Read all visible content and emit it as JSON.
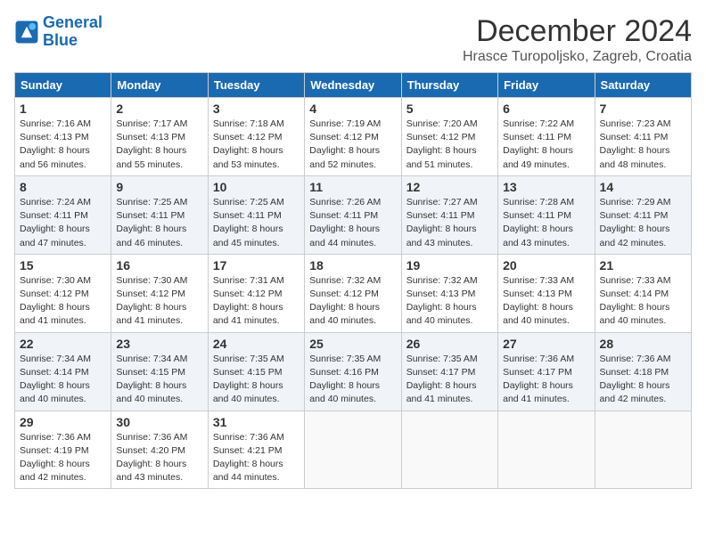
{
  "header": {
    "logo_line1": "General",
    "logo_line2": "Blue",
    "month": "December 2024",
    "location": "Hrasce Turopoljsko, Zagreb, Croatia"
  },
  "weekdays": [
    "Sunday",
    "Monday",
    "Tuesday",
    "Wednesday",
    "Thursday",
    "Friday",
    "Saturday"
  ],
  "weeks": [
    [
      {
        "day": "1",
        "sunrise": "Sunrise: 7:16 AM",
        "sunset": "Sunset: 4:13 PM",
        "daylight": "Daylight: 8 hours and 56 minutes."
      },
      {
        "day": "2",
        "sunrise": "Sunrise: 7:17 AM",
        "sunset": "Sunset: 4:13 PM",
        "daylight": "Daylight: 8 hours and 55 minutes."
      },
      {
        "day": "3",
        "sunrise": "Sunrise: 7:18 AM",
        "sunset": "Sunset: 4:12 PM",
        "daylight": "Daylight: 8 hours and 53 minutes."
      },
      {
        "day": "4",
        "sunrise": "Sunrise: 7:19 AM",
        "sunset": "Sunset: 4:12 PM",
        "daylight": "Daylight: 8 hours and 52 minutes."
      },
      {
        "day": "5",
        "sunrise": "Sunrise: 7:20 AM",
        "sunset": "Sunset: 4:12 PM",
        "daylight": "Daylight: 8 hours and 51 minutes."
      },
      {
        "day": "6",
        "sunrise": "Sunrise: 7:22 AM",
        "sunset": "Sunset: 4:11 PM",
        "daylight": "Daylight: 8 hours and 49 minutes."
      },
      {
        "day": "7",
        "sunrise": "Sunrise: 7:23 AM",
        "sunset": "Sunset: 4:11 PM",
        "daylight": "Daylight: 8 hours and 48 minutes."
      }
    ],
    [
      {
        "day": "8",
        "sunrise": "Sunrise: 7:24 AM",
        "sunset": "Sunset: 4:11 PM",
        "daylight": "Daylight: 8 hours and 47 minutes."
      },
      {
        "day": "9",
        "sunrise": "Sunrise: 7:25 AM",
        "sunset": "Sunset: 4:11 PM",
        "daylight": "Daylight: 8 hours and 46 minutes."
      },
      {
        "day": "10",
        "sunrise": "Sunrise: 7:25 AM",
        "sunset": "Sunset: 4:11 PM",
        "daylight": "Daylight: 8 hours and 45 minutes."
      },
      {
        "day": "11",
        "sunrise": "Sunrise: 7:26 AM",
        "sunset": "Sunset: 4:11 PM",
        "daylight": "Daylight: 8 hours and 44 minutes."
      },
      {
        "day": "12",
        "sunrise": "Sunrise: 7:27 AM",
        "sunset": "Sunset: 4:11 PM",
        "daylight": "Daylight: 8 hours and 43 minutes."
      },
      {
        "day": "13",
        "sunrise": "Sunrise: 7:28 AM",
        "sunset": "Sunset: 4:11 PM",
        "daylight": "Daylight: 8 hours and 43 minutes."
      },
      {
        "day": "14",
        "sunrise": "Sunrise: 7:29 AM",
        "sunset": "Sunset: 4:11 PM",
        "daylight": "Daylight: 8 hours and 42 minutes."
      }
    ],
    [
      {
        "day": "15",
        "sunrise": "Sunrise: 7:30 AM",
        "sunset": "Sunset: 4:12 PM",
        "daylight": "Daylight: 8 hours and 41 minutes."
      },
      {
        "day": "16",
        "sunrise": "Sunrise: 7:30 AM",
        "sunset": "Sunset: 4:12 PM",
        "daylight": "Daylight: 8 hours and 41 minutes."
      },
      {
        "day": "17",
        "sunrise": "Sunrise: 7:31 AM",
        "sunset": "Sunset: 4:12 PM",
        "daylight": "Daylight: 8 hours and 41 minutes."
      },
      {
        "day": "18",
        "sunrise": "Sunrise: 7:32 AM",
        "sunset": "Sunset: 4:12 PM",
        "daylight": "Daylight: 8 hours and 40 minutes."
      },
      {
        "day": "19",
        "sunrise": "Sunrise: 7:32 AM",
        "sunset": "Sunset: 4:13 PM",
        "daylight": "Daylight: 8 hours and 40 minutes."
      },
      {
        "day": "20",
        "sunrise": "Sunrise: 7:33 AM",
        "sunset": "Sunset: 4:13 PM",
        "daylight": "Daylight: 8 hours and 40 minutes."
      },
      {
        "day": "21",
        "sunrise": "Sunrise: 7:33 AM",
        "sunset": "Sunset: 4:14 PM",
        "daylight": "Daylight: 8 hours and 40 minutes."
      }
    ],
    [
      {
        "day": "22",
        "sunrise": "Sunrise: 7:34 AM",
        "sunset": "Sunset: 4:14 PM",
        "daylight": "Daylight: 8 hours and 40 minutes."
      },
      {
        "day": "23",
        "sunrise": "Sunrise: 7:34 AM",
        "sunset": "Sunset: 4:15 PM",
        "daylight": "Daylight: 8 hours and 40 minutes."
      },
      {
        "day": "24",
        "sunrise": "Sunrise: 7:35 AM",
        "sunset": "Sunset: 4:15 PM",
        "daylight": "Daylight: 8 hours and 40 minutes."
      },
      {
        "day": "25",
        "sunrise": "Sunrise: 7:35 AM",
        "sunset": "Sunset: 4:16 PM",
        "daylight": "Daylight: 8 hours and 40 minutes."
      },
      {
        "day": "26",
        "sunrise": "Sunrise: 7:35 AM",
        "sunset": "Sunset: 4:17 PM",
        "daylight": "Daylight: 8 hours and 41 minutes."
      },
      {
        "day": "27",
        "sunrise": "Sunrise: 7:36 AM",
        "sunset": "Sunset: 4:17 PM",
        "daylight": "Daylight: 8 hours and 41 minutes."
      },
      {
        "day": "28",
        "sunrise": "Sunrise: 7:36 AM",
        "sunset": "Sunset: 4:18 PM",
        "daylight": "Daylight: 8 hours and 42 minutes."
      }
    ],
    [
      {
        "day": "29",
        "sunrise": "Sunrise: 7:36 AM",
        "sunset": "Sunset: 4:19 PM",
        "daylight": "Daylight: 8 hours and 42 minutes."
      },
      {
        "day": "30",
        "sunrise": "Sunrise: 7:36 AM",
        "sunset": "Sunset: 4:20 PM",
        "daylight": "Daylight: 8 hours and 43 minutes."
      },
      {
        "day": "31",
        "sunrise": "Sunrise: 7:36 AM",
        "sunset": "Sunset: 4:21 PM",
        "daylight": "Daylight: 8 hours and 44 minutes."
      },
      null,
      null,
      null,
      null
    ]
  ]
}
